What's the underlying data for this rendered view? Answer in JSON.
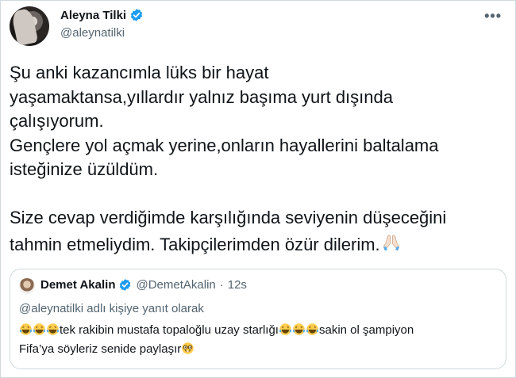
{
  "author": {
    "display_name": "Aleyna Tilki",
    "handle": "@aleynatilki",
    "verified": true
  },
  "more_label": "•••",
  "tweet": {
    "lines": [
      "Şu anki kazancımla lüks bir hayat",
      "yaşamaktansa,yıllardır yalnız başıma yurt dışında",
      "çalışıyorum.",
      "Gençlere yol açmak yerine,onların hayallerini baltalama",
      "isteğinize üzüldüm.",
      "",
      "Size cevap verdiğimde karşılığında seviyenin düşeceğini",
      "tahmin etmeliydim. Takipçilerimden özür dilerim."
    ],
    "trailing_emoji": "folded-hands-emoji"
  },
  "quote": {
    "display_name": "Demet Akalin",
    "handle": "@DemetAkalin",
    "separator": "·",
    "time": "12s",
    "verified": true,
    "reply_context": "@aleynatilki adlı kişiye yanıt olarak",
    "text_part1": "tek rakibin mustafa topaloğlu uzay starlığı",
    "text_part2": "sakin ol şampiyon",
    "text_line2": "Fifa’ya söyleriz senide paylaşır",
    "emojis": [
      "laughing-tears-emoji",
      "nerd-face-emoji"
    ]
  },
  "colors": {
    "verified_blue": "#1d9bf0",
    "secondary_text": "#536471",
    "border": "#cfd9de"
  }
}
